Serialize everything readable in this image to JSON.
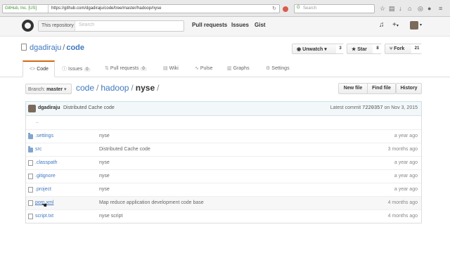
{
  "browser": {
    "ev_certificate": "GitHub, Inc. [US]",
    "url": "https://github.com/dgadiraju/code/tree/master/hadoop/nyse",
    "search_placeholder": "Search"
  },
  "header": {
    "scope_label": "This repository",
    "search_placeholder": "Search",
    "nav": [
      "Pull requests",
      "Issues",
      "Gist"
    ],
    "new_glyph": "+",
    "caret": "▾"
  },
  "repo": {
    "owner": "dgadiraju",
    "separator": "/",
    "name": "code",
    "unwatch_label": "Unwatch",
    "watch_count": "3",
    "star_label": "Star",
    "star_count": "8",
    "fork_label": "Fork",
    "fork_count": "21"
  },
  "tabs": [
    {
      "label": "Code",
      "icon": "code-icon",
      "glyph": "<>"
    },
    {
      "label": "Issues",
      "count": "0",
      "icon": "issue-icon",
      "glyph": "ⓘ"
    },
    {
      "label": "Pull requests",
      "count": "0",
      "icon": "pull-request-icon",
      "glyph": "⇅"
    },
    {
      "label": "Wiki",
      "icon": "wiki-icon",
      "glyph": "▤"
    },
    {
      "label": "Pulse",
      "icon": "pulse-icon",
      "glyph": "∿"
    },
    {
      "label": "Graphs",
      "icon": "graph-icon",
      "glyph": "▥"
    },
    {
      "label": "Settings",
      "icon": "gear-icon",
      "glyph": "⚙"
    }
  ],
  "file_nav": {
    "branch_prefix": "Branch:",
    "branch": "master",
    "breadcrumb": [
      "code",
      "hadoop",
      "nyse"
    ],
    "buttons": {
      "new_file": "New file",
      "find_file": "Find file",
      "history": "History"
    }
  },
  "commit": {
    "author": "dgadiraju",
    "message": "Distributed Cache code",
    "latest_label": "Latest commit",
    "sha": "7220357",
    "date": "on Nov 3, 2015"
  },
  "files": [
    {
      "name": "..",
      "type": "up",
      "message": "",
      "age": ""
    },
    {
      "name": ".settings",
      "type": "dir",
      "message": "nyse",
      "age": "a year ago"
    },
    {
      "name": "src",
      "type": "dir",
      "message": "Distributed Cache code",
      "age": "3 months ago"
    },
    {
      "name": ".classpath",
      "type": "file",
      "message": "nyse",
      "age": "a year ago"
    },
    {
      "name": ".gitignore",
      "type": "file",
      "message": "nyse",
      "age": "a year ago"
    },
    {
      "name": ".project",
      "type": "file",
      "message": "nyse",
      "age": "a year ago"
    },
    {
      "name": "pom.xml",
      "type": "file",
      "message": "Map reduce application development code base",
      "age": "4 months ago"
    },
    {
      "name": "script.txt",
      "type": "file",
      "message": "nyse script",
      "age": "4 months ago"
    }
  ],
  "colors": {
    "link": "#4078c0",
    "tab_accent": "#d26911",
    "commit_tease_bg": "#f2f8fa"
  }
}
